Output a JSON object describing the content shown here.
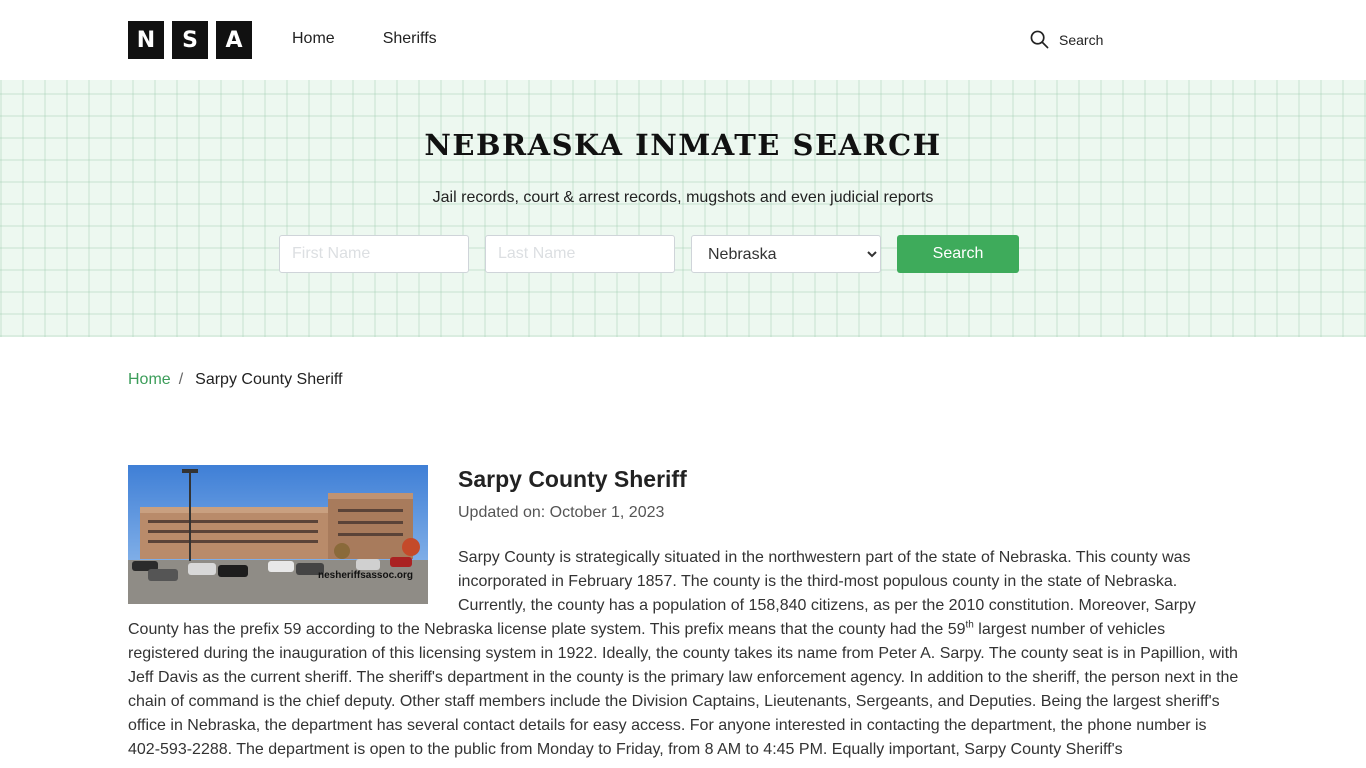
{
  "header": {
    "logo_letters": [
      "N",
      "S",
      "A"
    ],
    "nav": [
      {
        "label": "Home"
      },
      {
        "label": "Sheriffs"
      }
    ],
    "search_label": "Search"
  },
  "hero": {
    "title": "NEBRASKA INMATE SEARCH",
    "subtitle": "Jail records, court & arrest records, mugshots and even judicial reports",
    "first_name_placeholder": "First Name",
    "last_name_placeholder": "Last Name",
    "state_selected": "Nebraska",
    "search_button": "Search"
  },
  "breadcrumb": {
    "home": "Home",
    "separator": "/",
    "current": "Sarpy County Sheriff"
  },
  "article": {
    "title": "Sarpy County Sheriff",
    "updated_label": "Updated on:",
    "updated_date": "October 1, 2023",
    "image_watermark": "nesheriffsassoc.org",
    "body_part1": "Sarpy County is strategically situated in the northwestern part of the state of Nebraska. This county was incorporated in February 1857. The county is the third-most populous county in the state of Nebraska. Currently, the county has a population of 158,840 citizens, as per the 2010 constitution. Moreover, Sarpy County has the prefix 59 according to the Nebraska license plate system. This prefix means that the county had the 59",
    "body_sup": "th",
    "body_part2": " largest number of vehicles registered during the inauguration of this licensing system in 1922. Ideally, the county takes its name from Peter A. Sarpy. The county seat is in Papillion, with Jeff Davis as the current sheriff. The sheriff's department in the county is the primary law enforcement agency. In addition to the sheriff, the person next in the chain of command is the chief deputy. Other staff members include the Division Captains, Lieutenants, Sergeants, and Deputies. Being the largest sheriff's office in Nebraska, the department has several contact details for easy access. For anyone interested in contacting the department, the phone number is 402-593-2288. The department is open to the public from Monday to Friday, from 8 AM to 4:45 PM. Equally important, Sarpy County Sheriff's"
  },
  "colors": {
    "accent_green": "#3eab5b",
    "link_green": "#3c9d5a",
    "hero_bg": "#edf8f0"
  }
}
